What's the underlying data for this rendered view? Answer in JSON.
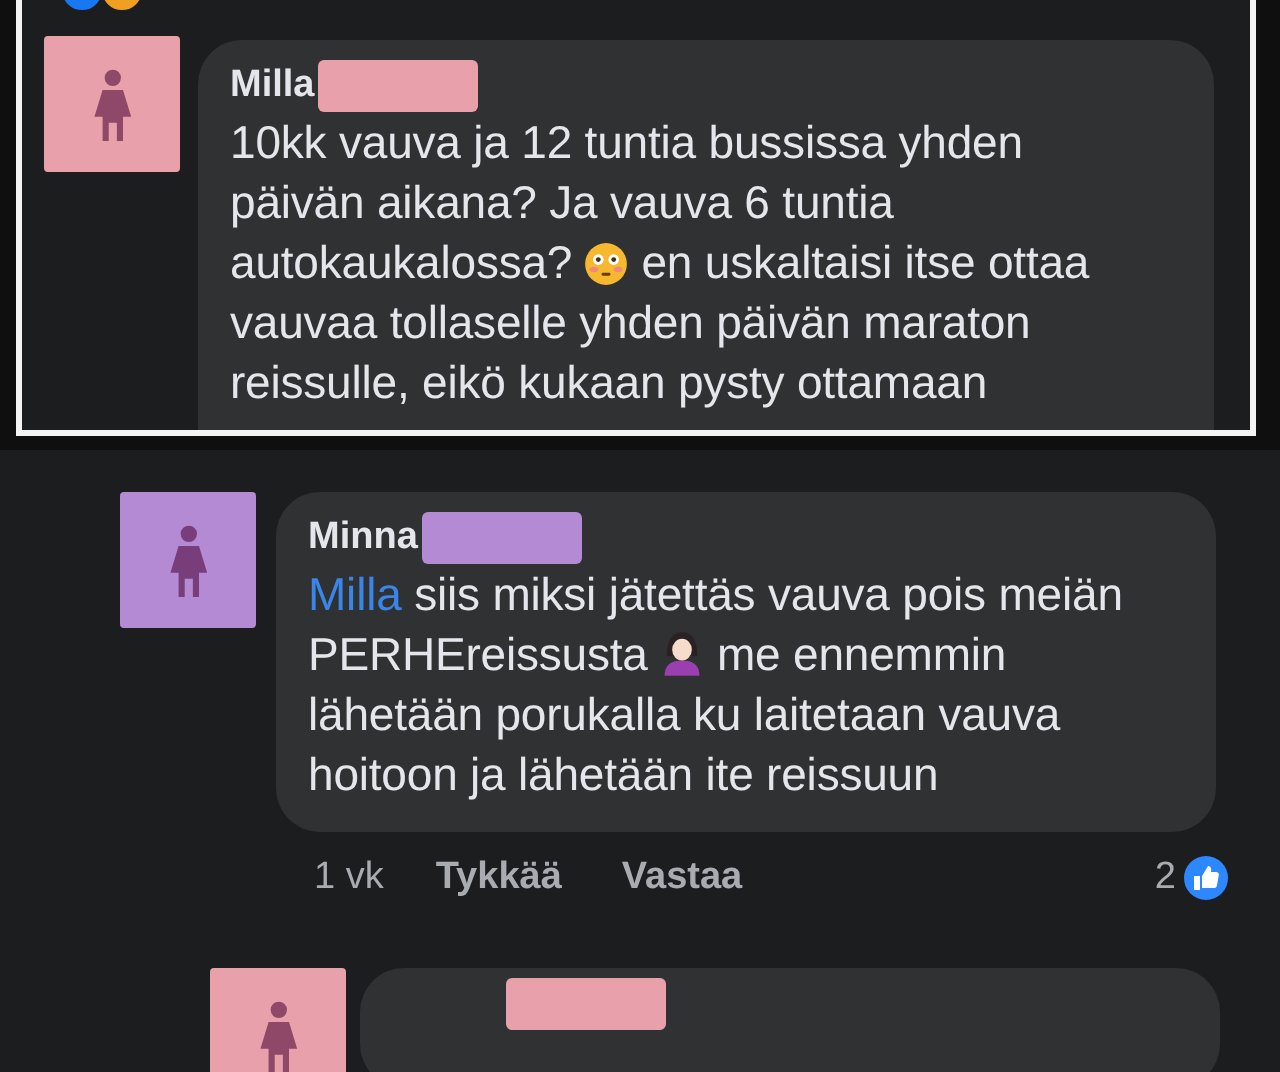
{
  "quoted_comment": {
    "author": "Milla",
    "color": "#e8a0aa",
    "body": [
      {
        "kind": "text",
        "text": "10kk vauva ja 12 tuntia bussissa yhden päivän aikana? Ja vauva 6 tuntia autokaukalossa?"
      },
      {
        "kind": "face"
      },
      {
        "kind": "text",
        "text": "en uskaltaisi itse ottaa vauvaa tollaselle yhden päivän maraton reissulle, eikö kukaan pysty ottamaan"
      }
    ]
  },
  "reply": {
    "author": "Minna",
    "color": "#b48ad4",
    "body": [
      {
        "kind": "mention",
        "text": "Milla"
      },
      {
        "kind": "text",
        "text": "siis miksi jätettäs vauva pois meiän PERHEreissusta"
      },
      {
        "kind": "person"
      },
      {
        "kind": "text",
        "text": "me ennemmin lähetään porukalla ku laitetaan vauva hoitoon ja lähetään ite reissuun"
      }
    ],
    "time": "1 vk",
    "actions": [
      "Tykkää",
      "Vastaa"
    ],
    "like_count": "2"
  },
  "next_reply": {
    "color": "#e8a0aa"
  }
}
